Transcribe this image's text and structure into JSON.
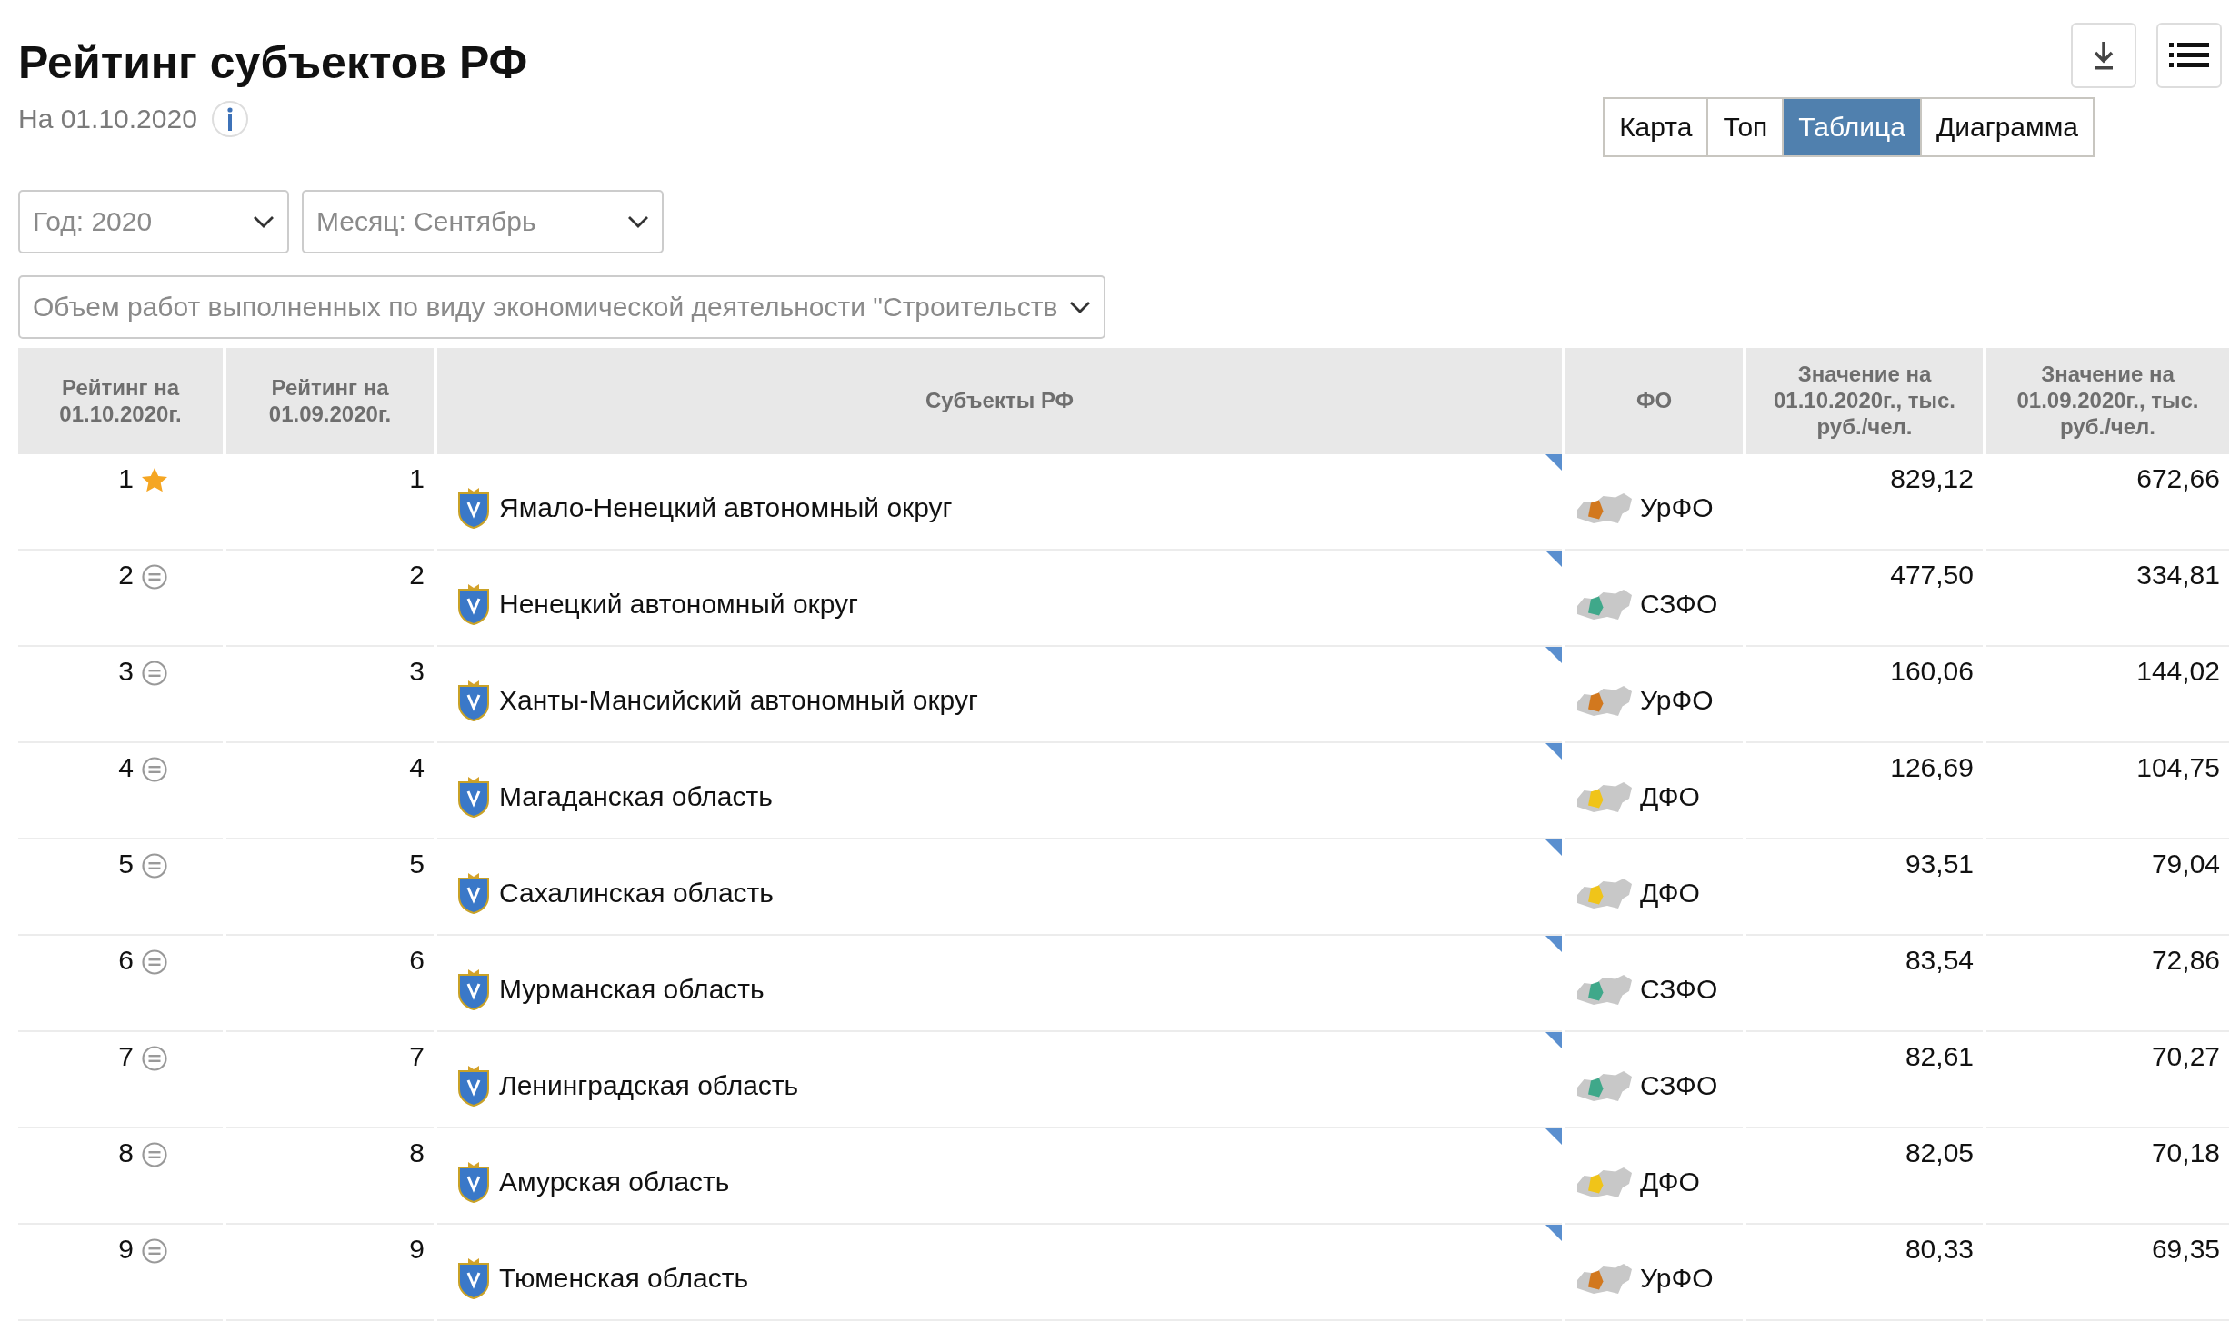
{
  "title": "Рейтинг субъектов РФ",
  "date": "На 01.10.2020",
  "views": [
    {
      "label": "Карта",
      "selected": false
    },
    {
      "label": "Топ",
      "selected": false
    },
    {
      "label": "Таблица",
      "selected": true
    },
    {
      "label": "Диаграмма",
      "selected": false
    }
  ],
  "filters": [
    {
      "value": "Год: 2020"
    },
    {
      "value": "Месяц: Сентябрь"
    }
  ],
  "indicator": {
    "value": "Объем работ выполненных по виду экономической деятельности \"Строительств"
  },
  "table": {
    "columns": [
      "Рейтинг на 01.10.2020г.",
      "Рейтинг на 01.09.2020г.",
      "Субъекты РФ",
      "ФО",
      "Значение на 01.10.2020г., тыс. руб./чел.",
      "Значение на 01.09.2020г., тыс. руб./чел."
    ],
    "rows": [
      {
        "rank": {
          "text": "1",
          "kind": "star"
        },
        "prev_rank": "1",
        "subject": "Ямало-Ненецкий автономный округ",
        "district": {
          "name": "УрФО",
          "color": "#d2781e"
        },
        "value": "829,12",
        "prev_value": "672,66"
      },
      {
        "rank": {
          "text": "2",
          "kind": "equal"
        },
        "prev_rank": "2",
        "subject": "Ненецкий автономный округ",
        "district": {
          "name": "СЗФО",
          "color": "#3fa88a"
        },
        "value": "477,50",
        "prev_value": "334,81"
      },
      {
        "rank": {
          "text": "3",
          "kind": "equal"
        },
        "prev_rank": "3",
        "subject": "Ханты-Мансийский автономный округ",
        "district": {
          "name": "УрФО",
          "color": "#d2781e"
        },
        "value": "160,06",
        "prev_value": "144,02"
      },
      {
        "rank": {
          "text": "4",
          "kind": "equal"
        },
        "prev_rank": "4",
        "subject": "Магаданская область",
        "district": {
          "name": "ДФО",
          "color": "#f0c419"
        },
        "value": "126,69",
        "prev_value": "104,75"
      },
      {
        "rank": {
          "text": "5",
          "kind": "equal"
        },
        "prev_rank": "5",
        "subject": "Сахалинская область",
        "district": {
          "name": "ДФО",
          "color": "#f0c419"
        },
        "value": "93,51",
        "prev_value": "79,04"
      },
      {
        "rank": {
          "text": "6",
          "kind": "equal"
        },
        "prev_rank": "6",
        "subject": "Мурманская область",
        "district": {
          "name": "СЗФО",
          "color": "#3fa88a"
        },
        "value": "83,54",
        "prev_value": "72,86"
      },
      {
        "rank": {
          "text": "7",
          "kind": "equal"
        },
        "prev_rank": "7",
        "subject": "Ленинградская область",
        "district": {
          "name": "СЗФО",
          "color": "#3fa88a"
        },
        "value": "82,61",
        "prev_value": "70,27"
      },
      {
        "rank": {
          "text": "8",
          "kind": "equal"
        },
        "prev_rank": "8",
        "subject": "Амурская область",
        "district": {
          "name": "ДФО",
          "color": "#f0c419"
        },
        "value": "82,05",
        "prev_value": "70,18"
      },
      {
        "rank": {
          "text": "9",
          "kind": "equal"
        },
        "prev_rank": "9",
        "subject": "Тюменская область",
        "district": {
          "name": "УрФО",
          "color": "#d2781e"
        },
        "value": "80,33",
        "prev_value": "69,35"
      }
    ]
  }
}
